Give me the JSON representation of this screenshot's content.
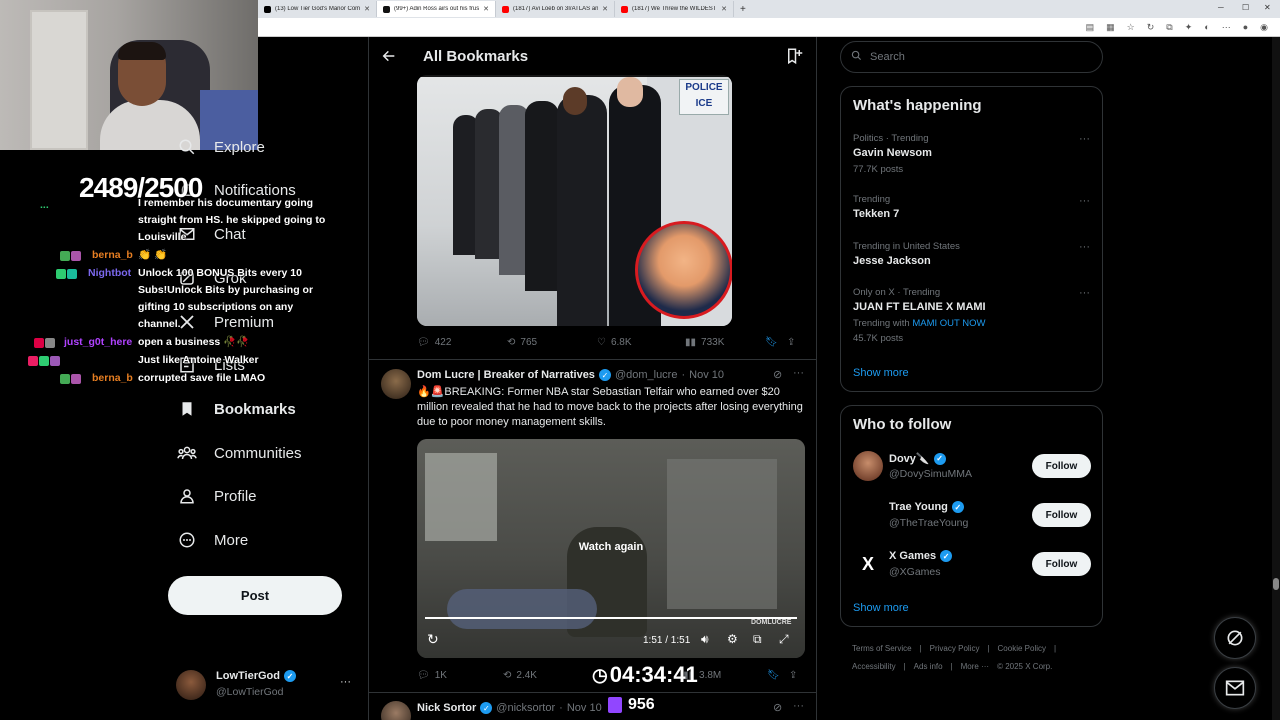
{
  "browser": {
    "tabs": [
      {
        "label": "(13) Low Tier God's Manor Comm",
        "color": "#000000"
      },
      {
        "label": "(99+) Adin Ross airs out his frustra",
        "color": "#111111"
      },
      {
        "label": "(1817) Avi Loeb on 3I/ATLAS and",
        "color": "#ff0000"
      },
      {
        "label": "(1817) We Threw the WILDEST Yo",
        "color": "#ff0000"
      }
    ],
    "new_tab": "+"
  },
  "stream_overlay": {
    "sub_counter": "2489/2500",
    "timer": "04:34:41",
    "viewer_count": "956",
    "chat": [
      {
        "user": "...",
        "user_color": "#2ecc71",
        "message": "I remember his documentary going"
      },
      {
        "user": "",
        "user_color": "#ffffff",
        "message": "straight from HS. he skipped going to"
      },
      {
        "user": "",
        "user_color": "#ffffff",
        "message": "Louisville"
      },
      {
        "user": "berna_b",
        "user_color": "#e67e22",
        "message": "👏 👏"
      },
      {
        "user": "Nightbot",
        "user_color": "#7b68ee",
        "message": "Unlock 100 BONUS Bits every 10"
      },
      {
        "user": "",
        "user_color": "#ffffff",
        "message": "Subs!Unlock Bits by purchasing or"
      },
      {
        "user": "",
        "user_color": "#ffffff",
        "message": "gifting 10 subscriptions on any"
      },
      {
        "user": "",
        "user_color": "#ffffff",
        "message": "channel."
      },
      {
        "user": "just_g0t_here",
        "user_color": "#b042ff",
        "message": "open a business 🥀🥀"
      },
      {
        "user": "",
        "user_color": "#3d4bd6",
        "message": "Just like Antoine Walker"
      },
      {
        "user": "berna_b",
        "user_color": "#e67e22",
        "message": "corrupted save file LMAO"
      }
    ]
  },
  "sidebar": {
    "items": [
      {
        "label": "Explore",
        "icon": "search-icon"
      },
      {
        "label": "Notifications",
        "icon": "bell-icon"
      },
      {
        "label": "Chat",
        "icon": "envelope-icon"
      },
      {
        "label": "Grok",
        "icon": "grok-icon"
      },
      {
        "label": "Premium",
        "icon": "x-logo-icon"
      },
      {
        "label": "Lists",
        "icon": "list-icon"
      },
      {
        "label": "Bookmarks",
        "icon": "bookmark-icon"
      },
      {
        "label": "Communities",
        "icon": "communities-icon"
      },
      {
        "label": "Profile",
        "icon": "person-icon"
      },
      {
        "label": "More",
        "icon": "more-circle-icon"
      }
    ],
    "post_button": "Post",
    "account": {
      "name": "LowTierGod",
      "handle": "@LowTierGod",
      "more": "···"
    }
  },
  "header": {
    "title": "All Bookmarks"
  },
  "tweets": [
    {
      "image_sign": "POLICE ICE",
      "stats": {
        "replies": "422",
        "reposts": "765",
        "likes": "6.8K",
        "views": "733K"
      }
    },
    {
      "name": "Dom Lucre | Breaker of Narratives",
      "handle": "@dom_lucre",
      "separator": "·",
      "date": "Nov 10",
      "text": "🔥🚨BREAKING: Former NBA star Sebastian Telfair who earned over $20 million revealed that he had to move back to the projects after losing everything due to poor money management skills.",
      "video": {
        "overlay": "Watch again",
        "time": "1:51 / 1:51",
        "progress": 1.0,
        "watermark": "DOMLUCRE"
      },
      "stats": {
        "replies": "1K",
        "reposts": "2.4K",
        "likes": "",
        "views": "3.8M"
      }
    },
    {
      "name": "Nick Sortor",
      "handle": "@nicksortor",
      "separator": "·",
      "date": "Nov 10"
    }
  ],
  "search": {
    "placeholder": "Search"
  },
  "trending": {
    "title": "What's happening",
    "items": [
      {
        "meta": "Politics · Trending",
        "name": "Gavin Newsom",
        "count": "77.7K posts"
      },
      {
        "meta": "Trending",
        "name": "Tekken 7",
        "count": ""
      },
      {
        "meta": "Trending in United States",
        "name": "Jesse Jackson",
        "count": ""
      },
      {
        "meta": "Only on X · Trending",
        "name": "JUAN FT ELAINE X MAMI",
        "trending_with_label": "Trending with",
        "trending_with": "MAMI OUT NOW",
        "count": "45.7K posts"
      }
    ],
    "show_more": "Show more",
    "more": "···"
  },
  "who_to_follow": {
    "title": "Who to follow",
    "items": [
      {
        "name": "Dovy🔪",
        "handle": "@DovySimuMMA",
        "button": "Follow"
      },
      {
        "name": "Trae Young",
        "handle": "@TheTraeYoung",
        "button": "Follow"
      },
      {
        "name": "X Games",
        "handle": "@XGames",
        "button": "Follow"
      }
    ],
    "show_more": "Show more"
  },
  "footer": {
    "links": [
      "Terms of Service",
      "|",
      "Privacy Policy",
      "|",
      "Cookie Policy",
      "|"
    ],
    "links2": [
      "Accessibility",
      "|",
      "Ads info",
      "|",
      "More ···",
      "© 2025 X Corp."
    ]
  },
  "colors": {
    "accent": "#1d9bf0",
    "background": "#000000",
    "text": "#e7e9ea",
    "muted": "#71767b"
  }
}
